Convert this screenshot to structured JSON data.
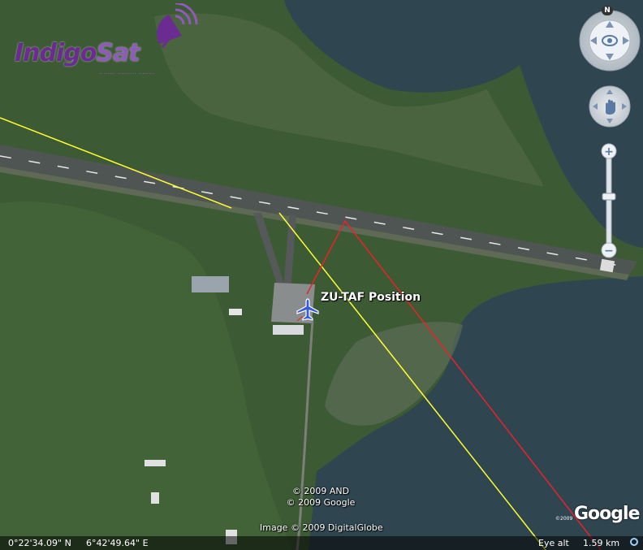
{
  "branding": {
    "name_part1": "Indigo",
    "name_part2": "Sat",
    "tagline": "........ ......... ........"
  },
  "map": {
    "aircraft_label": "ZU-TAF Position",
    "aircraft_icon": "airplane-icon",
    "colors": {
      "yellow_track": "#ffff33",
      "red_track": "#e8232b",
      "sea": "#2f4550",
      "land": "#3c5a34"
    }
  },
  "credits": {
    "line1": "© 2009 AND",
    "line2": "© 2009 Google",
    "image": "Image © 2009 DigitalGlobe",
    "google": "Google",
    "google_small": "©2009"
  },
  "navigation": {
    "north_label": "N",
    "zoom_in": "+",
    "zoom_out": "−",
    "zoom_level": 0.5
  },
  "status": {
    "latitude": "0°22'34.09\" N",
    "longitude": "6°42'49.64\" E",
    "eye_alt_label": "Eye alt",
    "eye_alt_value": "1.59 km"
  }
}
